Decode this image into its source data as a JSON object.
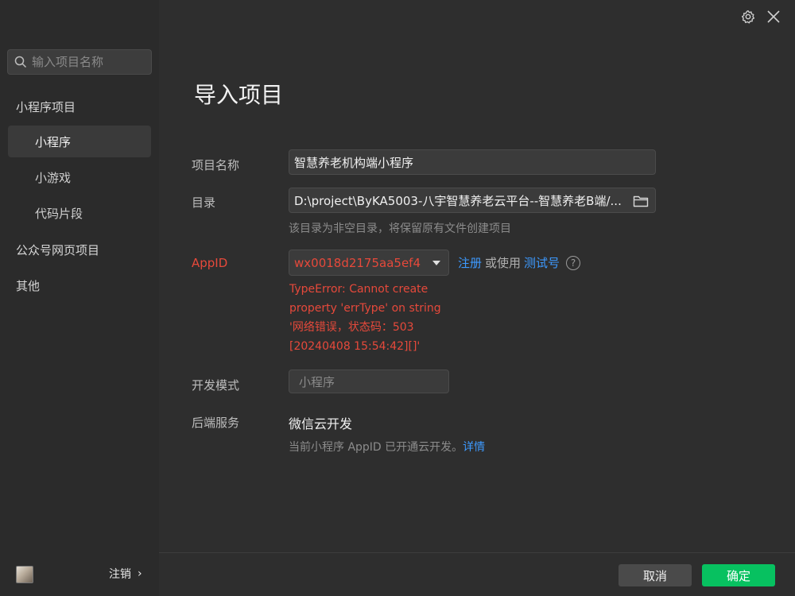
{
  "sidebar": {
    "search_placeholder": "输入项目名称",
    "groups": [
      {
        "label": "小程序项目"
      },
      {
        "label": "公众号网页项目"
      },
      {
        "label": "其他"
      }
    ],
    "sub_items": [
      {
        "label": "小程序",
        "active": true
      },
      {
        "label": "小游戏",
        "active": false
      },
      {
        "label": "代码片段",
        "active": false
      }
    ],
    "logout_label": "注销",
    "logout_chevron": "›"
  },
  "header": {
    "settings_icon": "gear-icon",
    "close_icon": "close-icon"
  },
  "main": {
    "title": "导入项目",
    "project_name_label": "项目名称",
    "project_name_value": "智慧养老机构端小程序",
    "directory_label": "目录",
    "directory_value": "D:\\project\\ByKA5003-八宇智慧养老云平台--智慧养老B端/...",
    "directory_hint": "该目录为非空目录，将保留原有文件创建项目",
    "appid_label": "AppID",
    "appid_value": "wx0018d2175aa5ef48",
    "register_link": "注册",
    "or_use_text": "或使用",
    "test_account_link": "测试号",
    "help_glyph": "?",
    "error_message": "TypeError: Cannot create property 'errType' on string '网络错误，状态码：503 [20240408 15:54:42][]'",
    "dev_mode_label": "开发模式",
    "dev_mode_value": "小程序",
    "backend_label": "后端服务",
    "backend_value": "微信云开发",
    "backend_hint": "当前小程序 AppID 已开通云开发。",
    "backend_hint_link": "详情"
  },
  "footer": {
    "cancel_label": "取消",
    "confirm_label": "确定"
  },
  "colors": {
    "accent_green": "#07c160",
    "error_red": "#e6493b",
    "link_blue": "#3d9aff"
  }
}
